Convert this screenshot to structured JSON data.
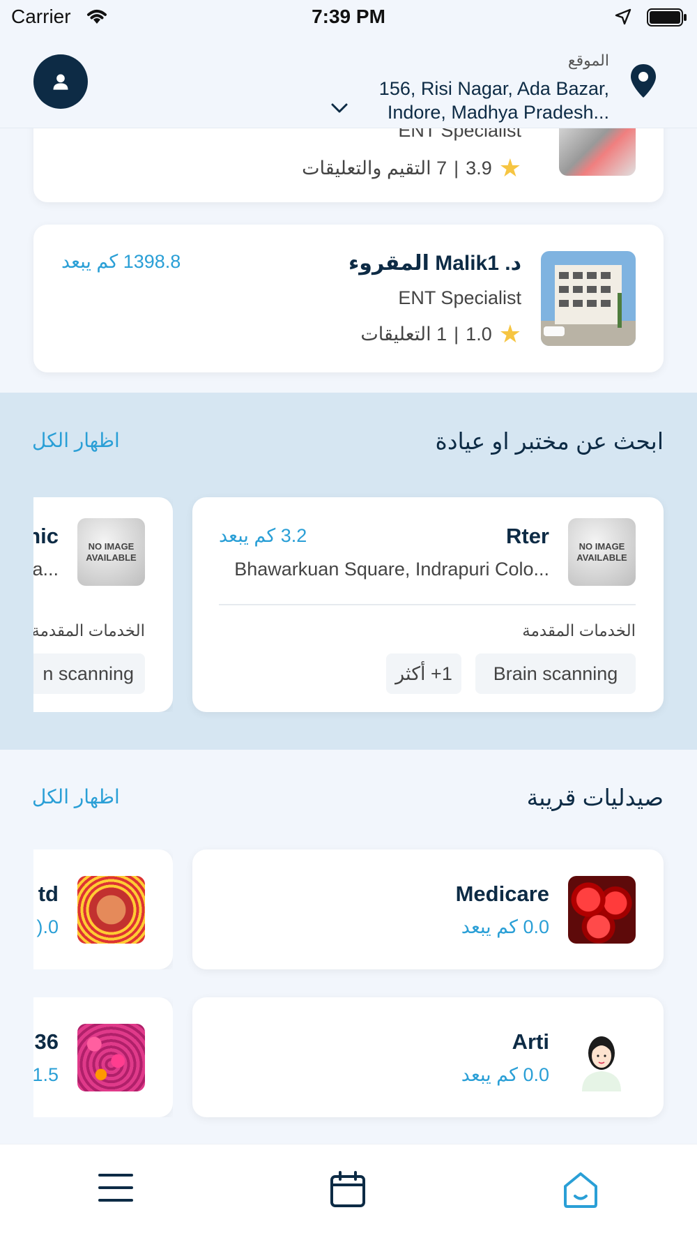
{
  "status_bar": {
    "carrier": "Carrier",
    "time": "7:39 PM"
  },
  "header": {
    "location_label": "الموقع",
    "address_line1": "156, Risi Nagar, Ada Bazar,",
    "address_line2": "Indore, Madhya Pradesh..."
  },
  "doctors": [
    {
      "specialty": "ENT Specialist",
      "rating": "3.9",
      "sep": "|",
      "reviews": "7 التقيم والتعليقات"
    },
    {
      "name": "د. Malik1 المقروء",
      "specialty": "ENT Specialist",
      "rating": "1.0",
      "sep": "|",
      "reviews": "1 التعليقات",
      "distance": "1398.8 كم يبعد"
    }
  ],
  "labs_section": {
    "title": "ابحث عن مختبر او عيادة",
    "view_all": "اظهار الكل",
    "no_image_text": "NO IMAGE AVAILABLE",
    "cards": [
      {
        "name": "Rter",
        "distance": "3.2 كم يبعد",
        "address": "Bhawarkuan Square, Indrapuri Colo...",
        "services_label": "الخدمات المقدمة",
        "service": "Brain scanning",
        "more": "1+ أكثر"
      },
      {
        "name": "nic",
        "address": "a...",
        "services_label": "الخدمات المقدمة",
        "service": "n scanning"
      }
    ]
  },
  "pharmacies_section": {
    "title": "صيدليات قريبة",
    "view_all": "اظهار الكل",
    "cards": [
      {
        "name": "Medicare",
        "distance": "0.0 كم يبعد"
      },
      {
        "name": "td",
        "distance": ").0"
      },
      {
        "name": "Arti",
        "distance": "0.0 كم يبعد"
      },
      {
        "name": "36",
        "distance": "1.5"
      }
    ]
  },
  "colors": {
    "navy": "#0d2b45",
    "accent": "#2a9fd6",
    "section_bg": "#d6e6f2",
    "star": "#f6c542"
  },
  "bottom_nav": {
    "icons": [
      "menu-icon",
      "calendar-icon",
      "home-icon"
    ]
  }
}
